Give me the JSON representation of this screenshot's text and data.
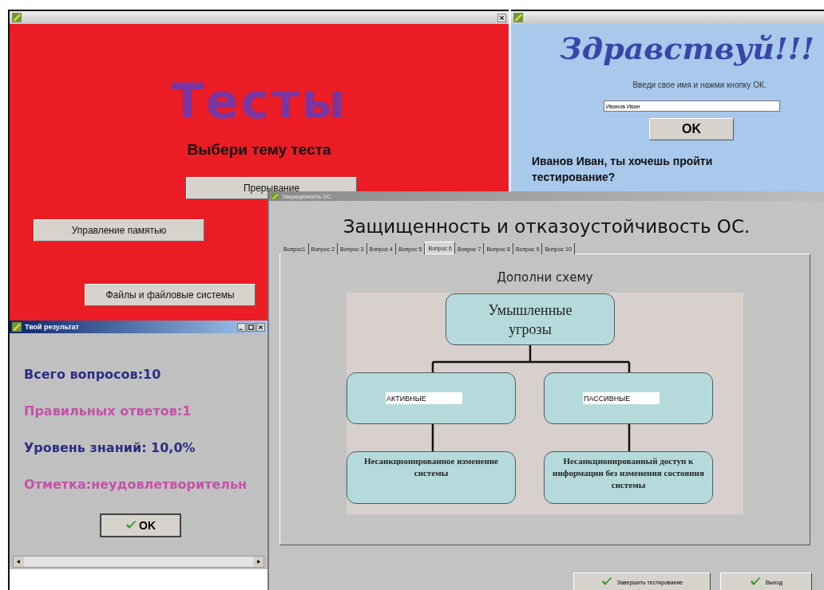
{
  "tests_window": {
    "title": "Тесты",
    "subtitle": "Выбери тему теста",
    "topic_buttons": [
      "Прерывание",
      "Управление памятью",
      "Файлы и файловые системы"
    ]
  },
  "greeting_window": {
    "title": "Здравствуй!!!",
    "prompt": "Введи свое имя и нажми кнопку ОК.",
    "name_field": {
      "value": "Иванов Иван"
    },
    "ok_button": "OK",
    "question": "Иванов Иван, ты хочешь пройти тестирование?"
  },
  "test_window": {
    "title": "Защищенность ОС",
    "heading": "Защищенность и отказоустойчивость ОС.",
    "tabs": [
      {
        "label": "Вопрос1",
        "selected": false
      },
      {
        "label": "Вопрос 2",
        "selected": false
      },
      {
        "label": "Вопрос 3",
        "selected": false
      },
      {
        "label": "Вопрос 4",
        "selected": false
      },
      {
        "label": "Вопрос 5",
        "selected": false
      },
      {
        "label": "Вопрос 6",
        "selected": true
      },
      {
        "label": "Вопрос 7",
        "selected": false
      },
      {
        "label": "Вопрос 8",
        "selected": false
      },
      {
        "label": "Вопрос 9",
        "selected": false
      },
      {
        "label": "Вопрос 10",
        "selected": false
      }
    ],
    "task": "Дополни схему",
    "diagram": {
      "root": "Умышленные угрозы",
      "branches": [
        {
          "answer": "АКТИВНЫЕ",
          "example": "Несанкционированное изменение системы"
        },
        {
          "answer": "ПАССИВНЫЕ",
          "example": "Несанкционированный доступ к информации без изменения состояния системы"
        }
      ]
    },
    "buttons": [
      "Завершить тестирование",
      "Выход"
    ]
  },
  "result_window": {
    "title": "Твой результат",
    "lines": [
      {
        "text": "Всего вопросов:10",
        "color": "#2b2d83"
      },
      {
        "text": "Правильных ответов:1",
        "color": "#c452a8"
      },
      {
        "text": "Уровень знаний: 10,0%",
        "color": "#2b2d83"
      },
      {
        "text": "Отметка:неудовлетворительн",
        "color": "#c452a8"
      }
    ],
    "ok_button": "OK"
  }
}
